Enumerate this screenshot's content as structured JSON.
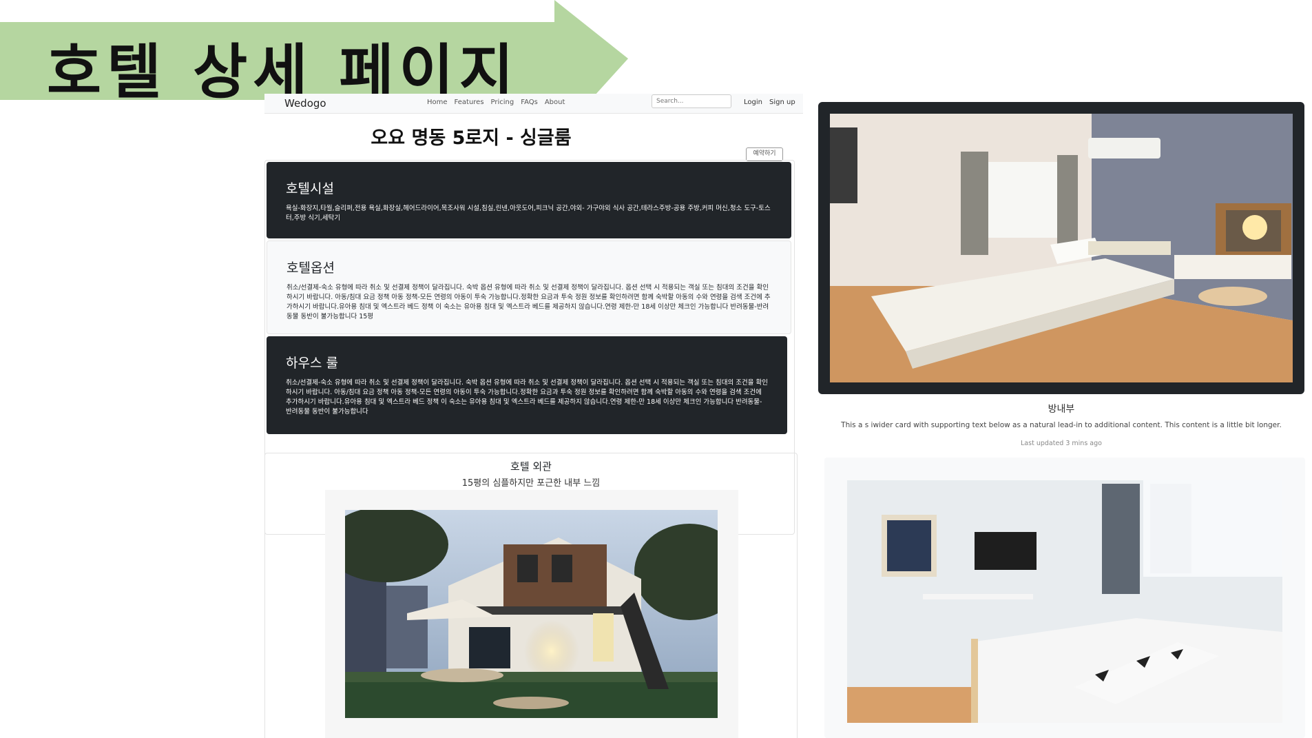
{
  "slide": {
    "title": "호텔 상세 페이지",
    "arrow_color": "#b5d6a0"
  },
  "navbar": {
    "brand": "Wedogo",
    "links": [
      "Home",
      "Features",
      "Pricing",
      "FAQs",
      "About"
    ],
    "search_placeholder": "Search...",
    "login": "Login",
    "signup": "Sign up"
  },
  "hotel": {
    "name": "오요 명동 5로지 - 싱글룸",
    "reserve_button": "예약하기"
  },
  "cards": [
    {
      "title": "호텔시설",
      "text": "욕실-화장지,타월,슬리퍼,전용 욕실,화장실,헤어드라이어,목조사워 시설,침실,린넨,아웃도어,피크닉 공간,야외- 가구야외 식사 공간,테라스주방-공용 주방,커피 머신,청소 도구-토스터,주방 식기,세탁기"
    },
    {
      "title": "호텔옵션",
      "text": "취소/선결제-숙소 유형에 따라 취소 및 선결제 정책이 달라집니다. 숙박 옵션 유형에 따라 취소 및 선결제 정책이 달라집니다. 옵션 선택 시 적용되는 객실 또는 침대의 조건을 확인하시기 바랍니다. 아동/침대 요금 정책 아동 정책-모든 연령의 아동이 투숙 가능합니다.정확한 요금과 투숙 정원 정보를 확인하려면 함께 숙박할 아동의 수와 연령을 검색 조건에 추가하시기 바랍니다.유아용 침대 및 엑스트라 베드 정책 이 숙소는 유아용 침대 및 엑스트라 베드를 제공하지 않습니다.연령 제한-만 18세 이상만 체크인 가능합니다 반려동물-반려동물 동반이 불가능합니다 15평"
    },
    {
      "title": "하우스 룰",
      "text": "취소/선결제-숙소 유형에 따라 취소 및 선결제 정책이 달라집니다. 숙박 옵션 유형에 따라 취소 및 선결제 정책이 달라집니다. 옵션 선택 시 적용되는 객실 또는 침대의 조건을 확인하시기 바랍니다. 아동/침대 요금 정책 아동 정책-모든 연령의 아동이 투숙 가능합니다.정확한 요금과 투숙 정원 정보를 확인하려면 함께 숙박할 아동의 수와 연령을 검색 조건에 추가하시기 바랍니다.유아용 침대 및 엑스트라 베드 정책 이 숙소는 유아용 침대 및 엑스트라 베드를 제공하지 않습니다.연령 제한-만 18세 이상만 체크인 가능합니다 반려동물-반려동물 동반이 불가능합니다"
    }
  ],
  "exterior": {
    "title": "호텔 외관",
    "subtitle": "15평의 심플하지만 포근한 내부 느낌"
  },
  "room_card": {
    "title": "방내부",
    "text": "This a s iwider card with supporting text below as a natural lead-in to additional content. This content is a little bit longer.",
    "updated": "Last updated 3 mins ago"
  }
}
